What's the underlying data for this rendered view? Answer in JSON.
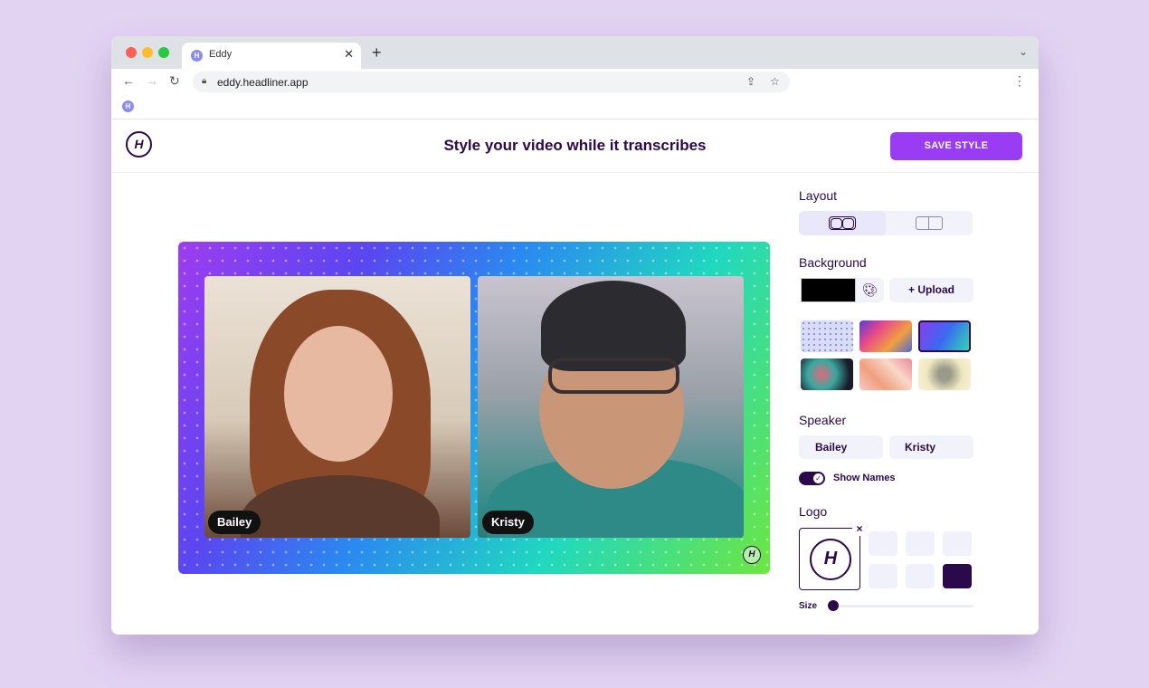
{
  "browser": {
    "tab_title": "Eddy",
    "tab_close": "✕",
    "new_tab": "+",
    "url": "eddy.headliner.app",
    "tab_favicon_letter": "H"
  },
  "app": {
    "title": "Style your video while it transcribes",
    "save_label": "SAVE STYLE",
    "logo_letter": "H"
  },
  "stage": {
    "speakers": [
      {
        "name": "Bailey"
      },
      {
        "name": "Kristy"
      }
    ],
    "watermark_letter": "H"
  },
  "panel": {
    "layout_label": "Layout",
    "background_label": "Background",
    "background_color": "#000000",
    "upload_label": "+ Upload",
    "speaker_label": "Speaker",
    "speaker_buttons": [
      "Bailey",
      "Kristy"
    ],
    "show_names_label": "Show Names",
    "show_names_on": true,
    "logo_label": "Logo",
    "logo_card_letter": "H",
    "size_label": "Size",
    "size_value": 0.0
  },
  "colors": {
    "accent": "#9b3cf5",
    "brand_dark": "#2a0a4a",
    "page_bg": "#e3d3f3"
  }
}
